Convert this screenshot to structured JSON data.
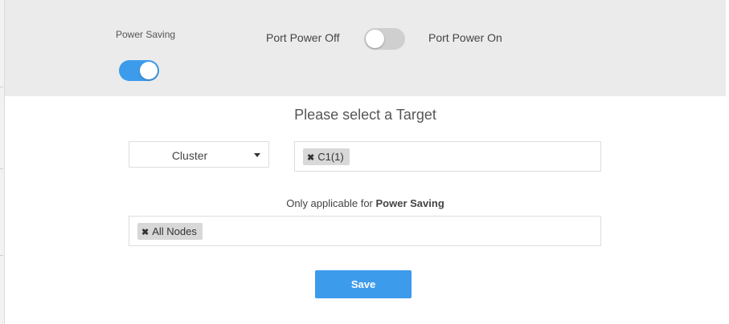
{
  "power_saving": {
    "label": "Power Saving",
    "enabled": true
  },
  "port_power": {
    "off_label": "Port Power Off",
    "on_label": "Port Power On",
    "enabled": false
  },
  "target": {
    "heading": "Please select a Target",
    "type_value": "Cluster",
    "selected_tags": [
      "C1(1)"
    ]
  },
  "applicable_note": {
    "prefix": "Only applicable for",
    "emphasis": "Power Saving"
  },
  "nodes": {
    "selected_tags": [
      "All Nodes"
    ]
  },
  "actions": {
    "save_label": "Save"
  },
  "colors": {
    "accent": "#3d9bec",
    "header_bg": "#ebebeb",
    "tag_bg": "#d8d8d8"
  }
}
